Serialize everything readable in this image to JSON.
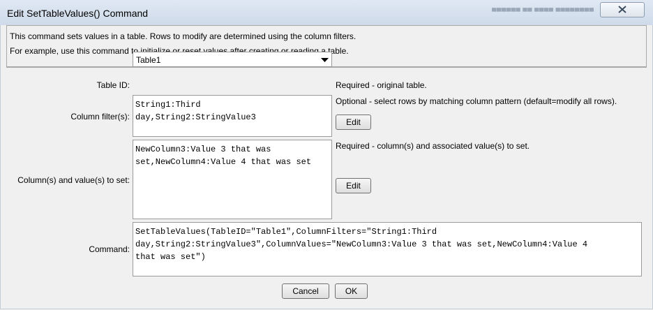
{
  "window": {
    "title": "Edit SetTableValues() Command",
    "faded_text": "▄▄▄▄▄▄  ▄▄ ▄▄▄▄ ▄▄▄▄▄▄▄▄"
  },
  "info": {
    "line1": "This command sets values in a table.  Rows to modify are determined using the column filters.",
    "line2": "For example, use this command to initialize or reset values after creating or reading a table."
  },
  "table_id": {
    "label": "Table ID:",
    "value": "Table1",
    "note": "Required - original table."
  },
  "column_filters": {
    "label": "Column filter(s):",
    "value": "String1:Third\nday,String2:StringValue3",
    "note": "Optional - select rows by matching column pattern (default=modify all rows).",
    "edit_label": "Edit"
  },
  "column_values": {
    "label": "Column(s) and value(s) to set:",
    "value": "NewColumn3:Value 3 that was\nset,NewColumn4:Value 4 that was set",
    "note": "Required - column(s) and associated value(s) to set.",
    "edit_label": "Edit"
  },
  "command": {
    "label": "Command:",
    "value": "SetTableValues(TableID=\"Table1\",ColumnFilters=\"String1:Third\nday,String2:StringValue3\",ColumnValues=\"NewColumn3:Value 3 that was set,NewColumn4:Value 4\nthat was set\")"
  },
  "buttons": {
    "cancel": "Cancel",
    "ok": "OK"
  },
  "icons": {
    "close": "close-icon",
    "dropdown": "chevron-down-icon"
  }
}
